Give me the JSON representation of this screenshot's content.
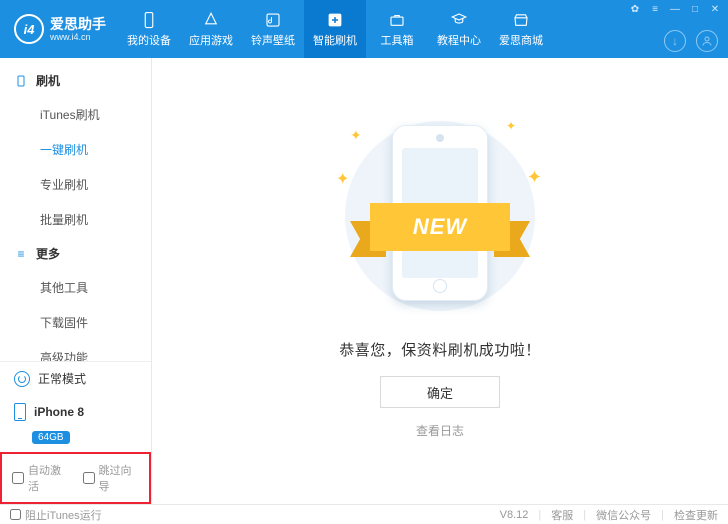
{
  "app": {
    "name": "爱思助手",
    "url": "www.i4.cn",
    "logo_text": "i4",
    "version": "V8.12"
  },
  "nav": {
    "items": [
      {
        "key": "device",
        "label": "我的设备"
      },
      {
        "key": "apps",
        "label": "应用游戏"
      },
      {
        "key": "ringtone",
        "label": "铃声壁纸"
      },
      {
        "key": "flash",
        "label": "智能刷机"
      },
      {
        "key": "toolbox",
        "label": "工具箱"
      },
      {
        "key": "tutorial",
        "label": "教程中心"
      },
      {
        "key": "mall",
        "label": "爱思商城"
      }
    ],
    "active_index": 3
  },
  "sidebar": {
    "groups": [
      {
        "title": "刷机",
        "items": [
          "iTunes刷机",
          "一键刷机",
          "专业刷机",
          "批量刷机"
        ],
        "active_index": 1
      },
      {
        "title": "更多",
        "items": [
          "其他工具",
          "下载固件",
          "高级功能"
        ],
        "active_index": -1
      }
    ],
    "mode_label": "正常模式",
    "device": {
      "name": "iPhone 8",
      "storage": "64GB"
    },
    "checks": {
      "auto_activate": "自动激活",
      "skip_wizard": "跳过向导"
    }
  },
  "main": {
    "ribbon": "NEW",
    "success_text": "恭喜您，保资料刷机成功啦！",
    "ok_button": "确定",
    "log_link": "查看日志"
  },
  "footer": {
    "block_itunes": "阻止iTunes运行",
    "links": [
      "客服",
      "微信公众号",
      "检查更新"
    ]
  }
}
